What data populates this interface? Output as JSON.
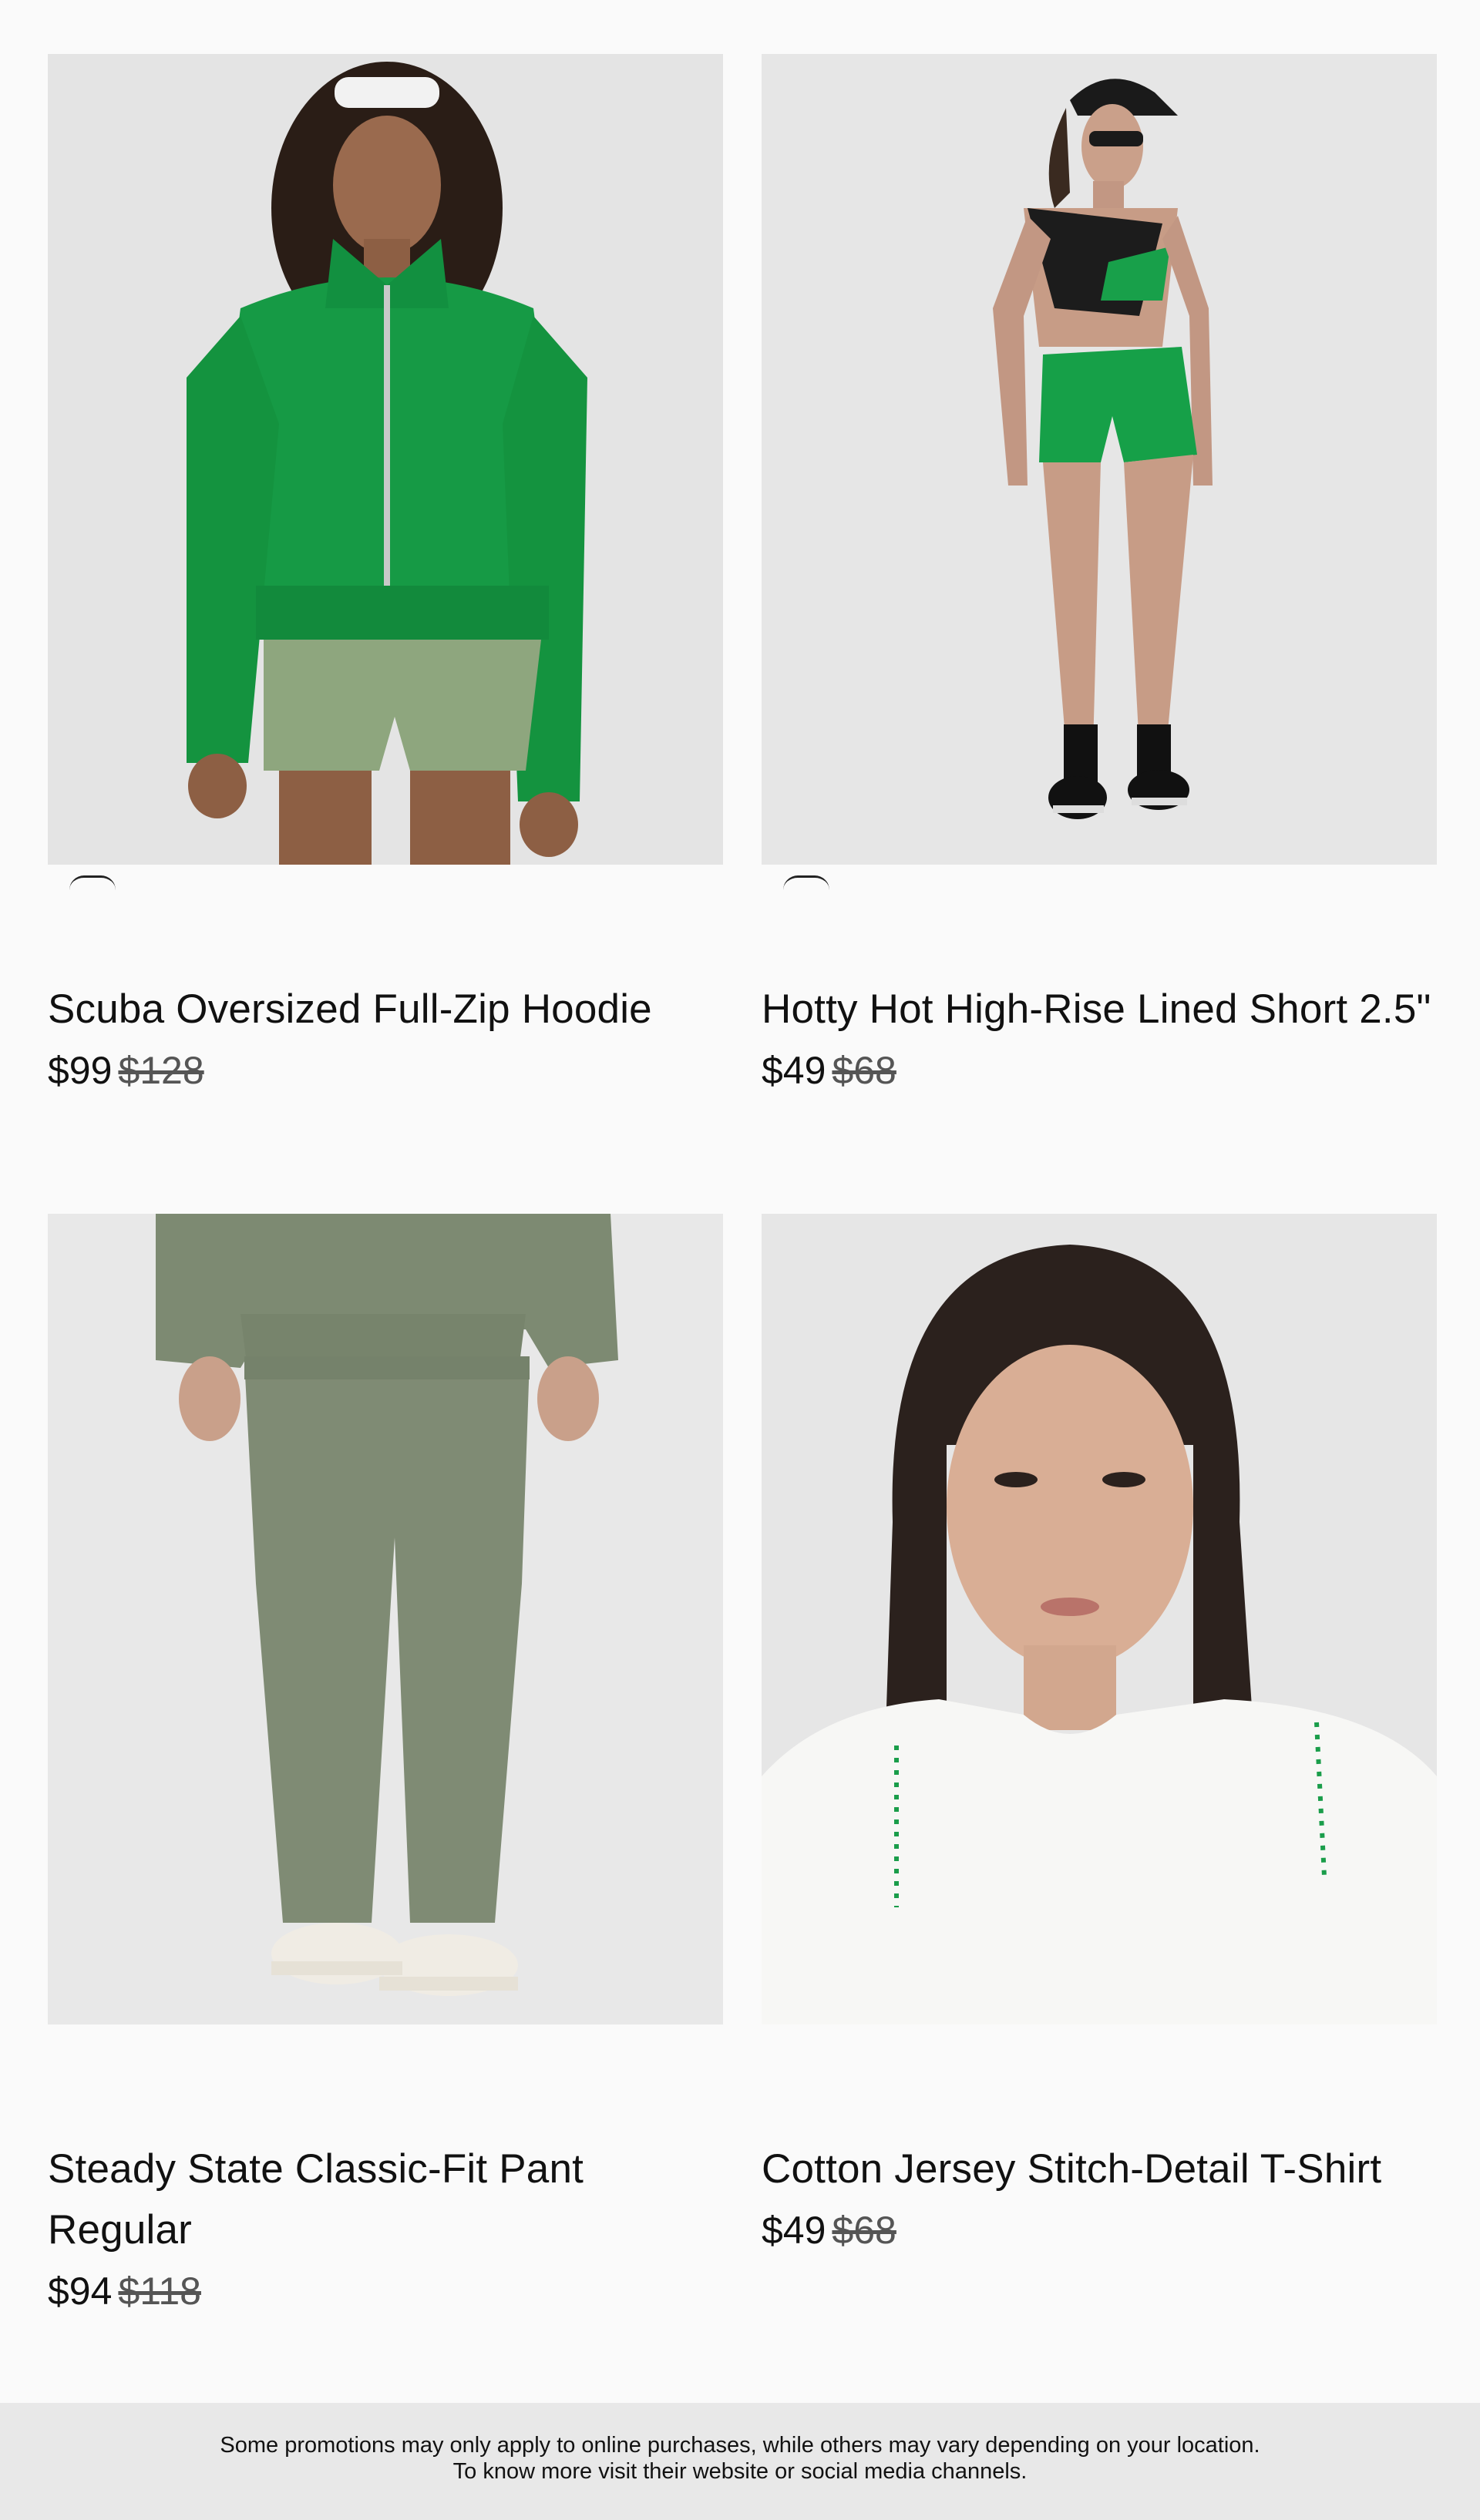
{
  "products": [
    {
      "title": "Scuba Oversized Full-Zip Hoodie",
      "price": "$99",
      "original_price": "$128",
      "image_icon": "model-green-hoodie-image"
    },
    {
      "title": "Hotty Hot High-Rise Lined Short 2.5\"",
      "price": "$49",
      "original_price": "$68",
      "image_icon": "model-green-shorts-image"
    },
    {
      "title": "Steady State Classic-Fit Pant Regular",
      "price": "$94",
      "original_price": "$118",
      "image_icon": "model-sage-pants-image"
    },
    {
      "title": "Cotton Jersey Stitch-Detail T-Shirt",
      "price": "$49",
      "original_price": "$68",
      "image_icon": "model-white-tshirt-image"
    }
  ],
  "footer": {
    "line1": "Some promotions may only apply to online purchases, while others may vary depending on your location.",
    "line2": "To know more visit their website or social media channels."
  },
  "colors": {
    "page_bg": "#fafafa",
    "image_bg": "#e6e6e6",
    "footer_bg": "#e8e8e8",
    "accent_green": "#1a9d4a",
    "sage": "#8a9a7c"
  }
}
